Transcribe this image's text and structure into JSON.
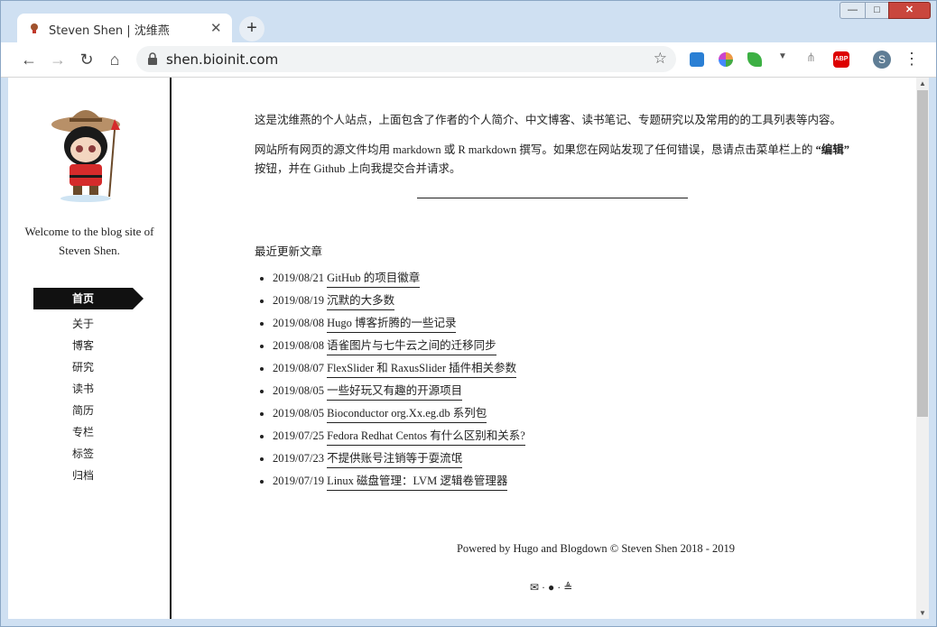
{
  "tab": {
    "title": "Steven Shen | 沈维燕"
  },
  "omnibox": {
    "url": "shen.bioinit.com"
  },
  "window": {
    "min": "—",
    "max": "□",
    "close": "✕"
  },
  "profile_initial": "S",
  "extensions": {
    "abp": "ABP"
  },
  "sidebar": {
    "welcome": "Welcome to the blog site of Steven Shen.",
    "nav_active": "首页",
    "nav_items": [
      "关于",
      "博客",
      "研究",
      "读书",
      "简历",
      "专栏",
      "标签",
      "归档"
    ]
  },
  "main": {
    "intro1": "这是沈维燕的个人站点，上面包含了作者的个人简介、中文博客、读书笔记、专题研究以及常用的的工具列表等内容。",
    "intro2_a": "网站所有网页的源文件均用 markdown 或 R markdown 撰写。如果您在网站发现了任何错误，恳请点击菜单栏上的 ",
    "intro2_bold": "“编辑”",
    "intro2_b": " 按钮，并在 Github 上向我提交合并请求。",
    "recent_heading": "最近更新文章",
    "posts": [
      {
        "date": "2019/08/21",
        "title": "GitHub 的项目徽章"
      },
      {
        "date": "2019/08/19",
        "title": "沉默的大多数"
      },
      {
        "date": "2019/08/08",
        "title": "Hugo 博客折腾的一些记录"
      },
      {
        "date": "2019/08/08",
        "title": "语雀图片与七牛云之间的迁移同步"
      },
      {
        "date": "2019/08/07",
        "title": "FlexSlider 和 RaxusSlider 插件相关参数"
      },
      {
        "date": "2019/08/05",
        "title": "一些好玩又有趣的开源项目"
      },
      {
        "date": "2019/08/05",
        "title": "Bioconductor org.Xx.eg.db 系列包"
      },
      {
        "date": "2019/07/25",
        "title": "Fedora Redhat Centos 有什么区别和关系?"
      },
      {
        "date": "2019/07/23",
        "title": "不提供账号注销等于耍流氓"
      },
      {
        "date": "2019/07/19",
        "title": "Linux 磁盘管理：LVM 逻辑卷管理器"
      }
    ],
    "footer": "Powered by Hugo and Blogdown © Steven Shen 2018 - 2019",
    "social": "✉ · ● · ≜"
  }
}
